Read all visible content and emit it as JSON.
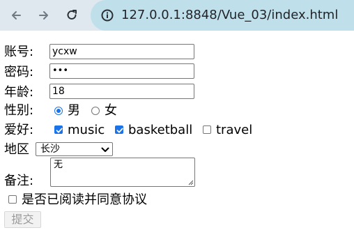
{
  "browser": {
    "url": "127.0.0.1:8848/Vue_03/index.html",
    "icons": {
      "back": "arrow-left-icon",
      "forward": "arrow-right-icon",
      "reload": "reload-icon",
      "site_info": "site-info-icon"
    }
  },
  "form": {
    "account": {
      "label": "账号:",
      "value": "ycxw"
    },
    "password": {
      "label": "密码:",
      "value": "•••"
    },
    "age": {
      "label": "年龄:",
      "value": "18"
    },
    "gender": {
      "label": "性别:",
      "options": [
        {
          "label": "男",
          "checked": true
        },
        {
          "label": "女",
          "checked": false
        }
      ]
    },
    "hobbies": {
      "label": "爱好:",
      "options": [
        {
          "label": "music",
          "checked": true
        },
        {
          "label": "basketball",
          "checked": true
        },
        {
          "label": "travel",
          "checked": false
        }
      ]
    },
    "region": {
      "label": "地区",
      "selected": "长沙"
    },
    "remarks": {
      "label": "备注:",
      "value": "无"
    },
    "agreement": {
      "label": "是否已阅读并同意协议",
      "checked": false
    },
    "submit_label": "提交"
  }
}
